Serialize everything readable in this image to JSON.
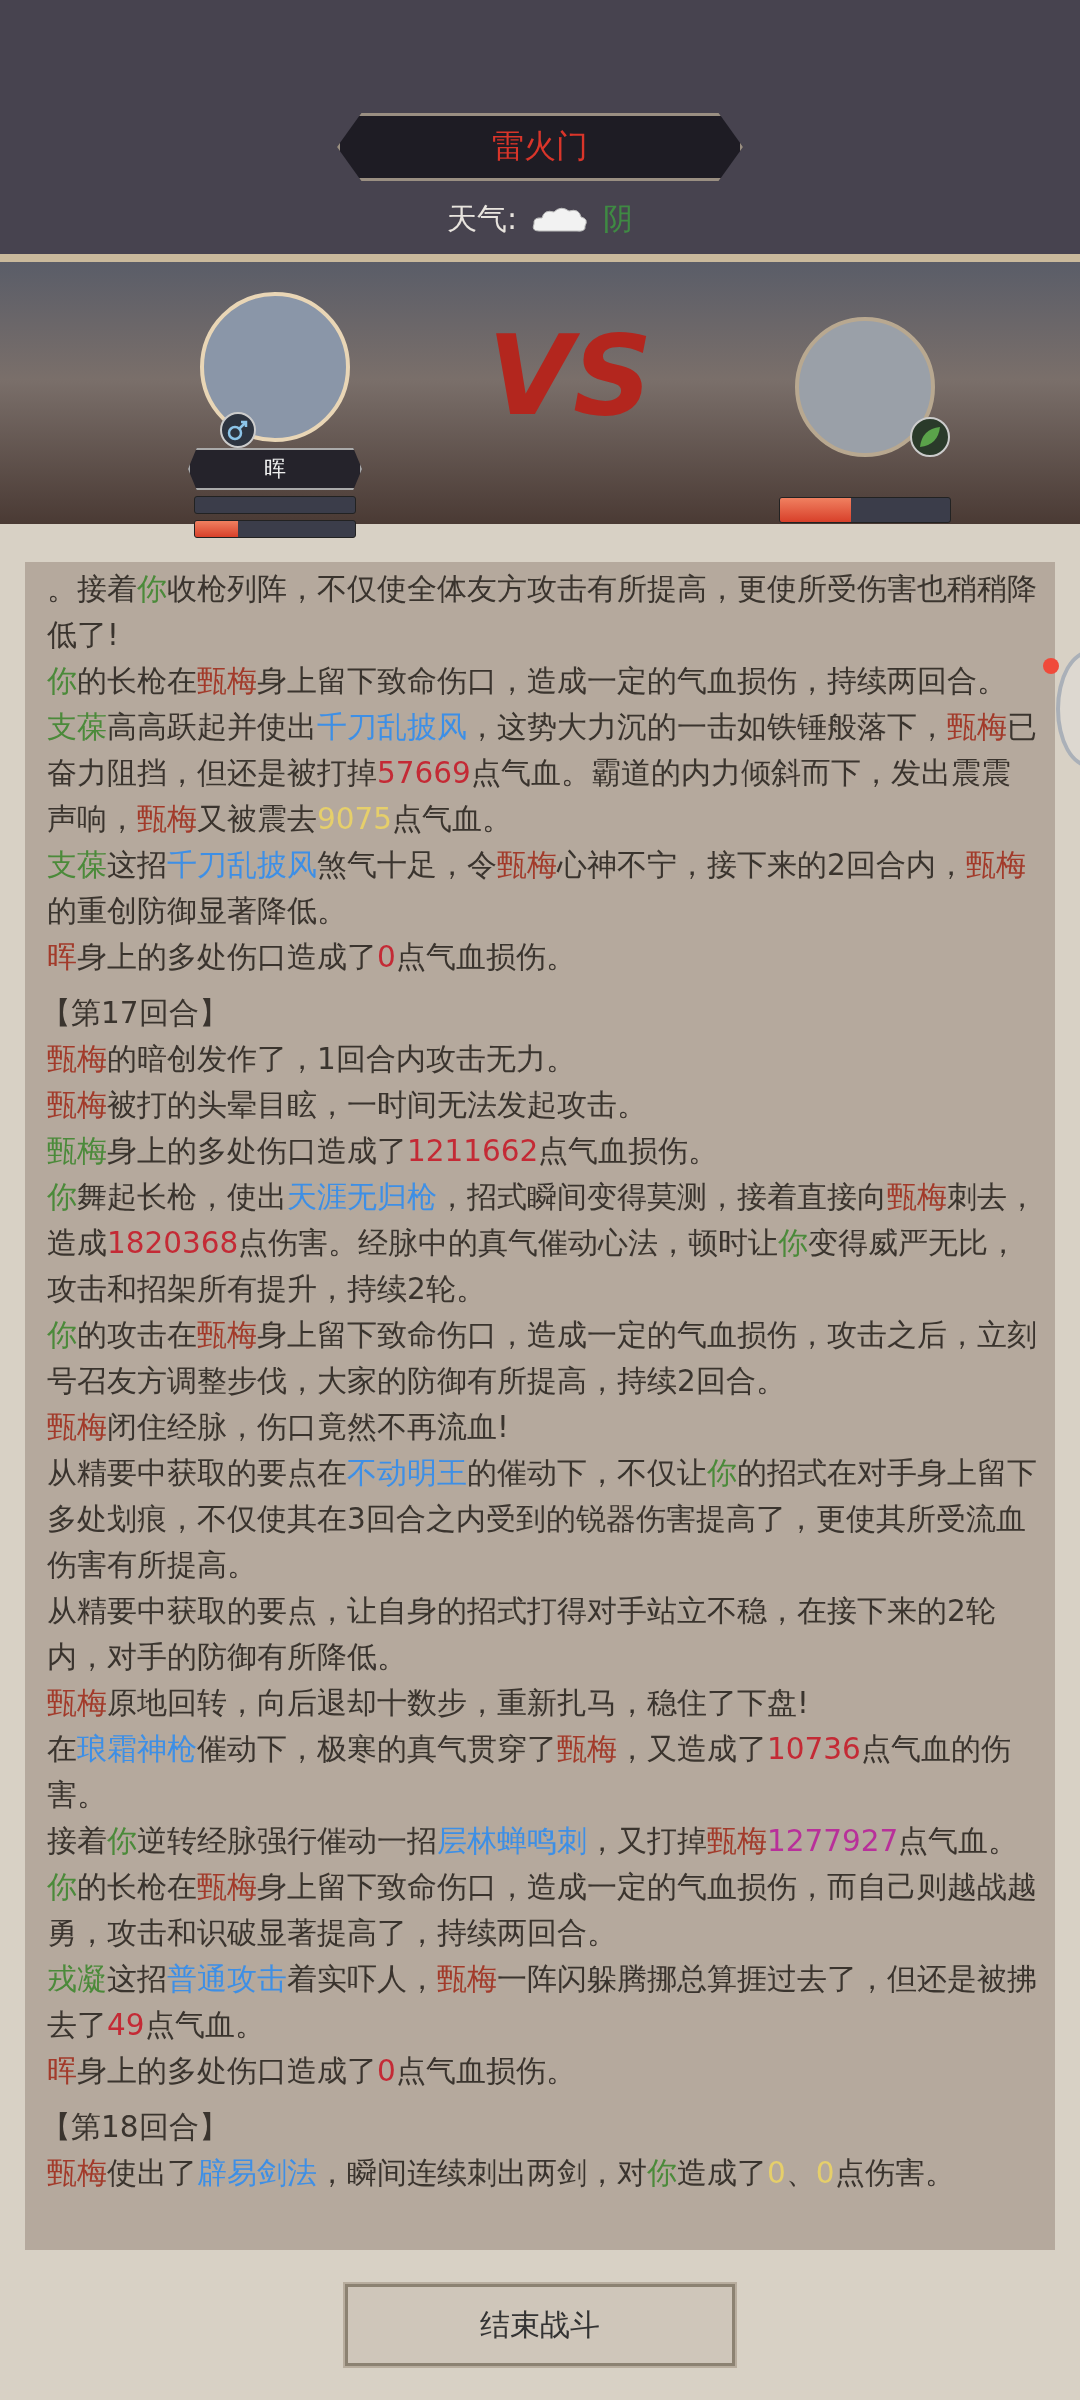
{
  "header": {
    "title": "雷火门",
    "weather_label": "天气:",
    "weather": "阴"
  },
  "battle": {
    "vs": "VS",
    "player": {
      "name": "晖",
      "hp": {
        "level": 0.27
      }
    },
    "enemy": {
      "hp": {
        "level": 0.42
      }
    }
  },
  "log": [
    {
      "kind": "line",
      "segments": [
        {
          "kind": "plain",
          "text": "。接着"
        },
        {
          "kind": "ally",
          "text": "你"
        },
        {
          "kind": "plain",
          "text": "收枪列阵，不仅使全体友方攻击有所提高，更使所受伤害也稍稍降低了!"
        }
      ]
    },
    {
      "kind": "line",
      "segments": [
        {
          "kind": "ally",
          "text": "你"
        },
        {
          "kind": "plain",
          "text": "的长枪在"
        },
        {
          "kind": "enemy",
          "text": "甄梅"
        },
        {
          "kind": "plain",
          "text": "身上留下致命伤口，造成一定的气血损伤，持续两回合。"
        }
      ]
    },
    {
      "kind": "line",
      "segments": [
        {
          "kind": "ally",
          "text": "支葆"
        },
        {
          "kind": "plain",
          "text": "高高跃起并使出"
        },
        {
          "kind": "skill",
          "text": "千刀乱披风"
        },
        {
          "kind": "plain",
          "text": "，这势大力沉的一击如铁锤般落下，"
        },
        {
          "kind": "enemy",
          "text": "甄梅"
        },
        {
          "kind": "plain",
          "text": "已奋力阻挡，但还是被打掉"
        },
        {
          "kind": "damage",
          "text": "57669"
        },
        {
          "kind": "plain",
          "text": "点气血。霸道的内力倾斜而下，发出震震声响，"
        },
        {
          "kind": "enemy",
          "text": "甄梅"
        },
        {
          "kind": "plain",
          "text": "又被震去"
        },
        {
          "kind": "minor",
          "text": "9075"
        },
        {
          "kind": "plain",
          "text": "点气血。"
        }
      ]
    },
    {
      "kind": "line",
      "segments": [
        {
          "kind": "ally",
          "text": "支葆"
        },
        {
          "kind": "plain",
          "text": "这招"
        },
        {
          "kind": "skill",
          "text": "千刀乱披风"
        },
        {
          "kind": "plain",
          "text": "煞气十足，令"
        },
        {
          "kind": "enemy",
          "text": "甄梅"
        },
        {
          "kind": "plain",
          "text": "心神不宁，接下来的2回合内，"
        },
        {
          "kind": "enemy",
          "text": "甄梅"
        },
        {
          "kind": "plain",
          "text": "的重创防御显著降低。"
        }
      ]
    },
    {
      "kind": "line",
      "segments": [
        {
          "kind": "enemy",
          "text": "晖"
        },
        {
          "kind": "plain",
          "text": "身上的多处伤口造成了"
        },
        {
          "kind": "damage",
          "text": "0"
        },
        {
          "kind": "plain",
          "text": "点气血损伤。"
        }
      ]
    },
    {
      "kind": "round",
      "text": "【第17回合】"
    },
    {
      "kind": "line",
      "segments": [
        {
          "kind": "enemy",
          "text": "甄梅"
        },
        {
          "kind": "plain",
          "text": "的暗创发作了，1回合内攻击无力。"
        }
      ]
    },
    {
      "kind": "line",
      "segments": [
        {
          "kind": "enemy",
          "text": "甄梅"
        },
        {
          "kind": "plain",
          "text": "被打的头晕目眩，一时间无法发起攻击。"
        }
      ]
    },
    {
      "kind": "line",
      "segments": [
        {
          "kind": "ally",
          "text": "甄梅"
        },
        {
          "kind": "plain",
          "text": "身上的多处伤口造成了"
        },
        {
          "kind": "damage",
          "text": "1211662"
        },
        {
          "kind": "plain",
          "text": "点气血损伤。"
        }
      ]
    },
    {
      "kind": "line",
      "segments": [
        {
          "kind": "ally",
          "text": "你"
        },
        {
          "kind": "plain",
          "text": "舞起长枪，使出"
        },
        {
          "kind": "skill",
          "text": "天涯无归枪"
        },
        {
          "kind": "plain",
          "text": "，招式瞬间变得莫测，接着直接向"
        },
        {
          "kind": "enemy",
          "text": "甄梅"
        },
        {
          "kind": "plain",
          "text": "刺去，造成"
        },
        {
          "kind": "damage",
          "text": "1820368"
        },
        {
          "kind": "plain",
          "text": "点伤害。经脉中的真气催动心法，顿时让"
        },
        {
          "kind": "ally",
          "text": "你"
        },
        {
          "kind": "plain",
          "text": "变得威严无比，攻击和招架所有提升，持续2轮。"
        }
      ]
    },
    {
      "kind": "line",
      "segments": [
        {
          "kind": "ally",
          "text": "你"
        },
        {
          "kind": "plain",
          "text": "的攻击在"
        },
        {
          "kind": "enemy",
          "text": "甄梅"
        },
        {
          "kind": "plain",
          "text": "身上留下致命伤口，造成一定的气血损伤，攻击之后，立刻号召友方调整步伐，大家的防御有所提高，持续2回合。"
        }
      ]
    },
    {
      "kind": "line",
      "segments": [
        {
          "kind": "enemy",
          "text": "甄梅"
        },
        {
          "kind": "plain",
          "text": "闭住经脉，伤口竟然不再流血!"
        }
      ]
    },
    {
      "kind": "line",
      "segments": [
        {
          "kind": "plain",
          "text": "从精要中获取的要点在"
        },
        {
          "kind": "skill",
          "text": "不动明王"
        },
        {
          "kind": "plain",
          "text": "的催动下，不仅让"
        },
        {
          "kind": "ally",
          "text": "你"
        },
        {
          "kind": "plain",
          "text": "的招式在对手身上留下多处划痕，不仅使其在3回合之内受到的锐器伤害提高了，更使其所受流血伤害有所提高。"
        }
      ]
    },
    {
      "kind": "line",
      "segments": [
        {
          "kind": "plain",
          "text": "从精要中获取的要点，让自身的招式打得对手站立不稳，在接下来的2轮内，对手的防御有所降低。"
        }
      ]
    },
    {
      "kind": "line",
      "segments": [
        {
          "kind": "enemy",
          "text": "甄梅"
        },
        {
          "kind": "plain",
          "text": "原地回转，向后退却十数步，重新扎马，稳住了下盘!"
        }
      ]
    },
    {
      "kind": "line",
      "segments": [
        {
          "kind": "plain",
          "text": "在"
        },
        {
          "kind": "skill",
          "text": "琅霜神枪"
        },
        {
          "kind": "plain",
          "text": "催动下，极寒的真气贯穿了"
        },
        {
          "kind": "enemy",
          "text": "甄梅"
        },
        {
          "kind": "plain",
          "text": "，又造成了"
        },
        {
          "kind": "damage",
          "text": "10736"
        },
        {
          "kind": "plain",
          "text": "点气血的伤害。"
        }
      ]
    },
    {
      "kind": "line",
      "segments": [
        {
          "kind": "plain",
          "text": "接着"
        },
        {
          "kind": "ally",
          "text": "你"
        },
        {
          "kind": "plain",
          "text": "逆转经脉强行催动一招"
        },
        {
          "kind": "skill",
          "text": "层林蝉鸣刺"
        },
        {
          "kind": "plain",
          "text": "，又打掉"
        },
        {
          "kind": "enemy",
          "text": "甄梅"
        },
        {
          "kind": "crit",
          "text": "1277927"
        },
        {
          "kind": "plain",
          "text": "点气血。"
        }
      ]
    },
    {
      "kind": "line",
      "segments": [
        {
          "kind": "ally",
          "text": "你"
        },
        {
          "kind": "plain",
          "text": "的长枪在"
        },
        {
          "kind": "enemy",
          "text": "甄梅"
        },
        {
          "kind": "plain",
          "text": "身上留下致命伤口，造成一定的气血损伤，而自己则越战越勇，攻击和识破显著提高了，持续两回合。"
        }
      ]
    },
    {
      "kind": "line",
      "segments": [
        {
          "kind": "ally",
          "text": "戎凝"
        },
        {
          "kind": "plain",
          "text": "这招"
        },
        {
          "kind": "skill",
          "text": "普通攻击"
        },
        {
          "kind": "plain",
          "text": "着实吓人，"
        },
        {
          "kind": "enemy",
          "text": "甄梅"
        },
        {
          "kind": "plain",
          "text": "一阵闪躲腾挪总算捱过去了，但还是被拂去了"
        },
        {
          "kind": "damage",
          "text": "49"
        },
        {
          "kind": "plain",
          "text": "点气血。"
        }
      ]
    },
    {
      "kind": "line",
      "segments": [
        {
          "kind": "enemy",
          "text": "晖"
        },
        {
          "kind": "plain",
          "text": "身上的多处伤口造成了"
        },
        {
          "kind": "damage",
          "text": "0"
        },
        {
          "kind": "plain",
          "text": "点气血损伤。"
        }
      ]
    },
    {
      "kind": "round",
      "text": "【第18回合】"
    },
    {
      "kind": "line",
      "segments": [
        {
          "kind": "enemy",
          "text": "甄梅"
        },
        {
          "kind": "plain",
          "text": "使出了"
        },
        {
          "kind": "skill",
          "text": "辟易剑法"
        },
        {
          "kind": "plain",
          "text": "，瞬间连续刺出两剑，对"
        },
        {
          "kind": "ally",
          "text": "你"
        },
        {
          "kind": "plain",
          "text": "造成了"
        },
        {
          "kind": "minor",
          "text": "0"
        },
        {
          "kind": "plain",
          "text": "、"
        },
        {
          "kind": "minor",
          "text": "0"
        },
        {
          "kind": "plain",
          "text": "点伤害。"
        }
      ]
    }
  ],
  "button": "结束战斗"
}
